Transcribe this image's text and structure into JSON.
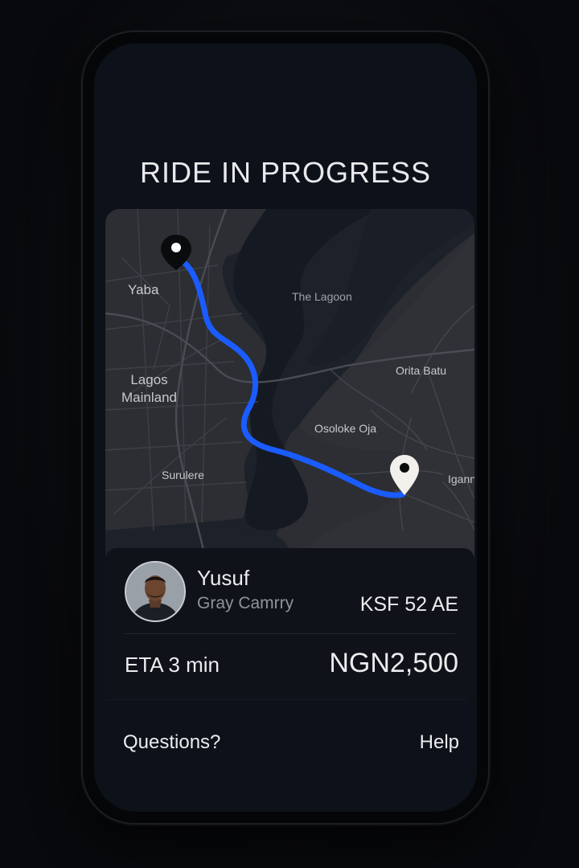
{
  "screen": {
    "title": "RIDE IN PROGRESS"
  },
  "map": {
    "labels": {
      "yaba": "Yaba",
      "lagoon": "The Lagoon",
      "orita_batu": "Orita Batu",
      "lagos_mainland_line1": "Lagos",
      "lagos_mainland_line2": "Mainland",
      "osoloke_oja": "Osoloke Oja",
      "surulere": "Surulere",
      "igann": "Igann"
    },
    "route_color": "#1a5cff",
    "origin_pin": "map-pin-icon",
    "destination_pin": "map-pin-icon"
  },
  "driver": {
    "name": "Yusuf",
    "car": "Gray Camrry",
    "plate": "KSF 52 AE",
    "avatar": "driver-avatar"
  },
  "trip": {
    "eta": "ETA 3 min",
    "fare": "NGN2,500"
  },
  "footer": {
    "questions": "Questions?",
    "help": "Help"
  }
}
